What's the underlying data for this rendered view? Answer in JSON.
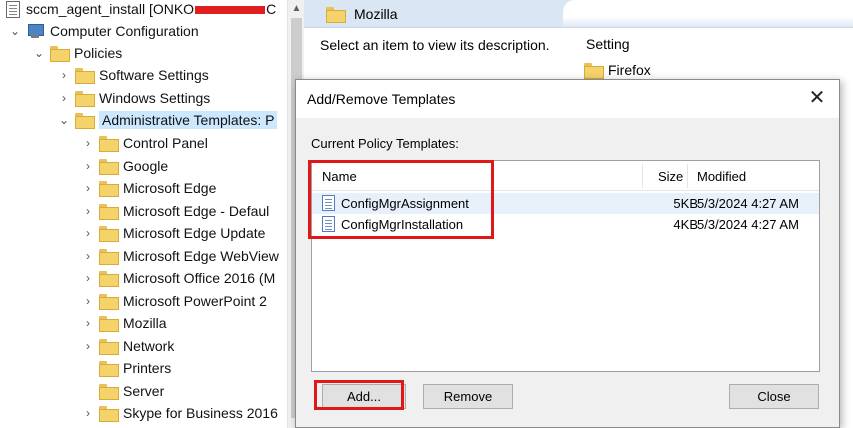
{
  "tree": {
    "root_label_prefix": "sccm_agent_install [ONKO",
    "root_label_suffix": "C",
    "computer_configuration": "Computer Configuration",
    "policies": "Policies",
    "software_settings": "Software Settings",
    "windows_settings": "Windows Settings",
    "administrative_templates": "Administrative Templates: P",
    "children": [
      "Control Panel",
      "Google",
      "Microsoft Edge",
      "Microsoft Edge - Defaul",
      "Microsoft Edge Update",
      "Microsoft Edge WebView",
      "Microsoft Office 2016 (M",
      "Microsoft PowerPoint 2",
      "Mozilla",
      "Network",
      "Printers",
      "Server",
      "Skype for Business 2016"
    ]
  },
  "right_pane": {
    "header_title": "Mozilla",
    "description": "Select an item to view its description.",
    "column_setting": "Setting",
    "items": [
      "Firefox"
    ]
  },
  "dialog": {
    "title": "Add/Remove Templates",
    "current_label": "Current Policy Templates:",
    "columns": {
      "name": "Name",
      "size": "Size",
      "modified": "Modified"
    },
    "rows": [
      {
        "name": "ConfigMgrAssignment",
        "size": "5KB",
        "modified": "5/3/2024 4:27 AM"
      },
      {
        "name": "ConfigMgrInstallation",
        "size": "4KB",
        "modified": "5/3/2024 4:27 AM"
      }
    ],
    "buttons": {
      "add": "Add...",
      "remove": "Remove",
      "close": "Close"
    },
    "close_glyph": "✕"
  },
  "colors": {
    "highlight": "#e01818",
    "header_bg": "#dbe6f4",
    "folder": "#f5d36b"
  },
  "icons": {
    "tree": [
      "document-icon",
      "computer-icon",
      "folder-icon",
      "chevron-right-icon",
      "chevron-down-icon"
    ],
    "dialog": [
      "template-file-icon",
      "close-icon"
    ]
  }
}
